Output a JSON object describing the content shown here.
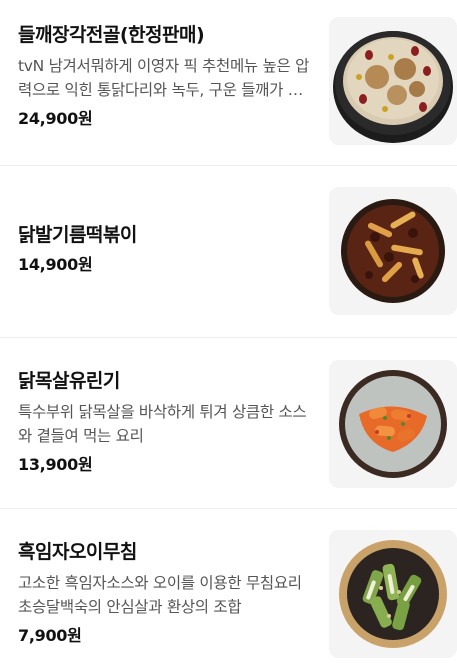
{
  "items": [
    {
      "name": "들깨장각전골(한정판매)",
      "description": "tvN 남겨서뭐하게 이영자 픽 추천메뉴 높은 압력으로 익힌 통닭다리와 녹두, 구운 들깨가 어우러진 전골",
      "price": "24,900원",
      "image": "perilla-chicken-hotpot-image"
    },
    {
      "name": "닭발기름떡볶이",
      "description": "",
      "price": "14,900원",
      "image": "chicken-feet-tteokbokki-image"
    },
    {
      "name": "닭목살유린기",
      "description": "특수부위 닭목살을 바삭하게 튀겨 상큼한 소스와 곁들여 먹는 요리",
      "price": "13,900원",
      "image": "chicken-neck-yuringi-image"
    },
    {
      "name": "흑임자오이무침",
      "description": "고소한 흑임자소스와 오이를 이용한 무침요리 초승달백숙의 안심살과 환상의 조합",
      "price": "7,900원",
      "image": "black-sesame-cucumber-salad-image"
    }
  ]
}
